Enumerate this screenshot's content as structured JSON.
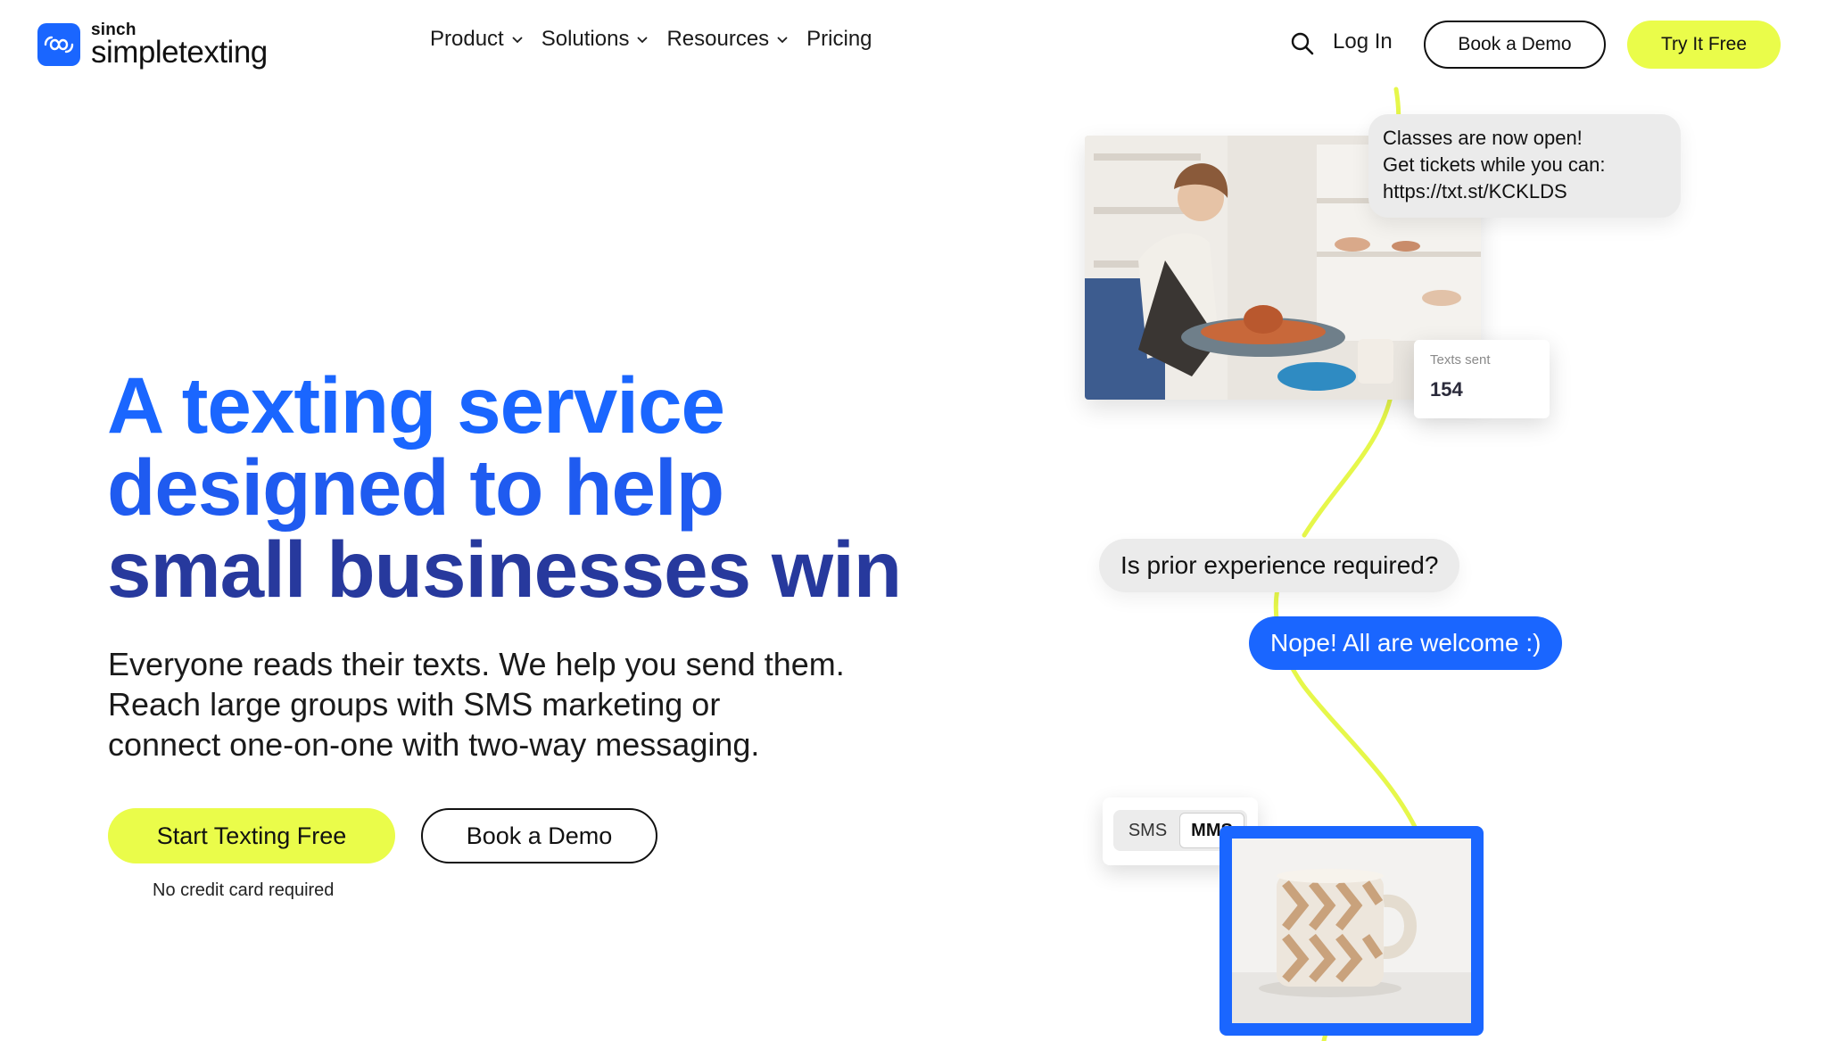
{
  "brand": {
    "company": "sinch",
    "product": "simpletexting",
    "accent": "#1a66ff",
    "lime": "#eafc4a"
  },
  "nav": {
    "items": [
      {
        "label": "Product",
        "icon": "chevron-down-icon"
      },
      {
        "label": "Solutions",
        "icon": "chevron-down-icon"
      },
      {
        "label": "Resources",
        "icon": "chevron-down-icon"
      },
      {
        "label": "Pricing"
      }
    ],
    "search_icon": "search-icon",
    "login": "Log In",
    "book_demo": "Book a Demo",
    "try_free": "Try It Free"
  },
  "hero": {
    "headline_line1": "A texting service",
    "headline_line2": "designed to help",
    "headline_line3": "small businesses win",
    "sub_line1": "Everyone reads their texts. We help you send them.",
    "sub_line2": "Reach large groups with SMS marketing or",
    "sub_line3": "connect one-on-one with two-way messaging.",
    "cta_primary": "Start Texting Free",
    "cta_secondary": "Book a Demo",
    "cta_note": "No credit card required"
  },
  "illustration": {
    "message1_line1": "Classes are now open!",
    "message1_line2": "Get tickets while you can:",
    "message1_line3": "https://txt.st/KCKLDS",
    "stat_label": "Texts sent",
    "stat_value": "154",
    "question": "Is prior experience required?",
    "reply": "Nope! All are welcome :)",
    "toggle_options": [
      "SMS",
      "MMS"
    ],
    "toggle_selected": "MMS"
  }
}
